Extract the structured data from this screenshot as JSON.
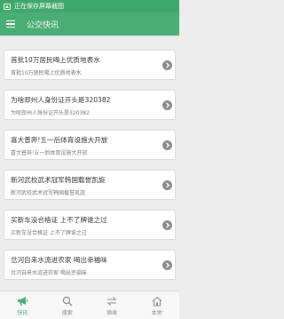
{
  "status_bar": {
    "text": "正在保存屏幕截图"
  },
  "app_bar": {
    "title": "公交快讯"
  },
  "articles": [
    {
      "title": "首批10万居民喝上优质地表水",
      "summary": "首批10万居民喝上优质地表水"
    },
    {
      "title": "为啥邳州人身份证开头是320382",
      "summary": "为啥邳州人身份证开头是320382"
    },
    {
      "title": "喜大普奔!五一后体育设施大开放",
      "summary": "喜大普奔!五一后体育设施大开放"
    },
    {
      "title": "新河武校武术冠军韩国载誉凯旋",
      "summary": "新河武校武术冠军韩国载誉凯旋"
    },
    {
      "title": "买新车没合格证 上不了牌谁之过",
      "summary": "买新车没合格证 上不了牌谁之过"
    },
    {
      "title": "岔河自来水流进农家 喝出幸福味",
      "summary": "岔河自来水流进农家 喝出幸福味"
    }
  ],
  "tabs": [
    {
      "label": "快讯",
      "icon": "megaphone-icon"
    },
    {
      "label": "搜索",
      "icon": "search-icon"
    },
    {
      "label": "换乘",
      "icon": "transfer-icon"
    },
    {
      "label": "本地",
      "icon": "home-icon"
    }
  ],
  "colors": {
    "status_bar": "#3fa76a",
    "app_bar": "#4aae74",
    "accent": "#4aae74",
    "chevron_bg": "#8a8a8a"
  }
}
